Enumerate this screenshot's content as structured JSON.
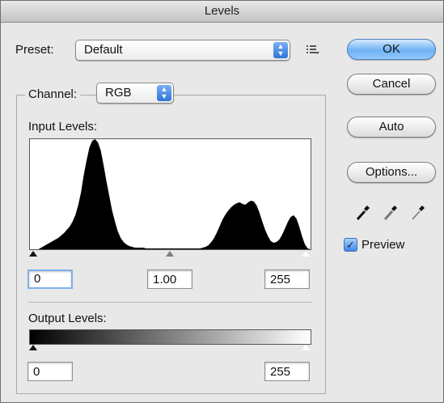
{
  "window": {
    "title": "Levels"
  },
  "preset": {
    "label": "Preset:",
    "value": "Default"
  },
  "channel": {
    "label": "Channel:",
    "value": "RGB"
  },
  "input_levels": {
    "label": "Input Levels:",
    "black": "0",
    "gamma": "1.00",
    "white": "255"
  },
  "output_levels": {
    "label": "Output Levels:",
    "black": "0",
    "white": "255"
  },
  "buttons": {
    "ok": "OK",
    "cancel": "Cancel",
    "auto": "Auto",
    "options": "Options..."
  },
  "preview": {
    "label": "Preview",
    "checked": true
  },
  "icons": {
    "preset_menu": "preset-options-icon",
    "eyedroppers": [
      "black-point-eyedropper-icon",
      "gray-point-eyedropper-icon",
      "white-point-eyedropper-icon"
    ]
  },
  "histogram": {
    "bins": [
      0,
      0,
      0,
      0,
      2,
      4,
      6,
      8,
      10,
      12,
      14,
      17,
      20,
      24,
      28,
      34,
      42,
      54,
      70,
      92,
      110,
      126,
      134,
      136,
      132,
      122,
      104,
      84,
      66,
      48,
      34,
      22,
      14,
      9,
      6,
      4,
      3,
      2,
      2,
      2,
      2,
      1,
      1,
      1,
      1,
      1,
      1,
      1,
      1,
      1,
      1,
      1,
      1,
      1,
      1,
      1,
      1,
      1,
      1,
      1,
      1,
      2,
      3,
      5,
      9,
      14,
      21,
      29,
      37,
      43,
      48,
      52,
      55,
      57,
      58,
      56,
      55,
      58,
      60,
      59,
      54,
      45,
      34,
      24,
      16,
      10,
      8,
      9,
      12,
      18,
      26,
      34,
      40,
      42,
      38,
      28,
      16,
      6,
      1,
      0
    ],
    "max": 136
  }
}
